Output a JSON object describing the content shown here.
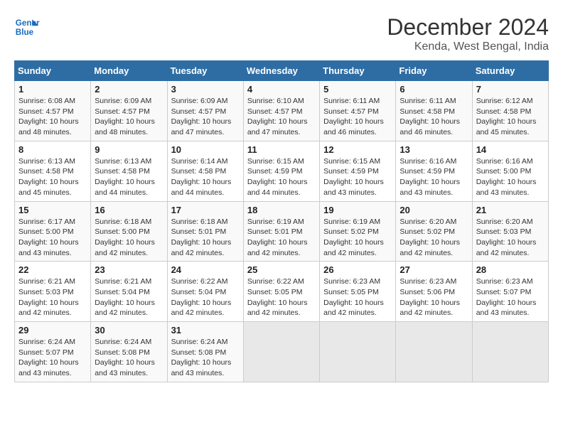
{
  "logo": {
    "line1": "General",
    "line2": "Blue"
  },
  "title": "December 2024",
  "subtitle": "Kenda, West Bengal, India",
  "weekdays": [
    "Sunday",
    "Monday",
    "Tuesday",
    "Wednesday",
    "Thursday",
    "Friday",
    "Saturday"
  ],
  "weeks": [
    [
      {
        "day": "1",
        "sunrise": "6:08 AM",
        "sunset": "4:57 PM",
        "daylight": "10 hours and 48 minutes."
      },
      {
        "day": "2",
        "sunrise": "6:09 AM",
        "sunset": "4:57 PM",
        "daylight": "10 hours and 48 minutes."
      },
      {
        "day": "3",
        "sunrise": "6:09 AM",
        "sunset": "4:57 PM",
        "daylight": "10 hours and 47 minutes."
      },
      {
        "day": "4",
        "sunrise": "6:10 AM",
        "sunset": "4:57 PM",
        "daylight": "10 hours and 47 minutes."
      },
      {
        "day": "5",
        "sunrise": "6:11 AM",
        "sunset": "4:57 PM",
        "daylight": "10 hours and 46 minutes."
      },
      {
        "day": "6",
        "sunrise": "6:11 AM",
        "sunset": "4:58 PM",
        "daylight": "10 hours and 46 minutes."
      },
      {
        "day": "7",
        "sunrise": "6:12 AM",
        "sunset": "4:58 PM",
        "daylight": "10 hours and 45 minutes."
      }
    ],
    [
      {
        "day": "8",
        "sunrise": "6:13 AM",
        "sunset": "4:58 PM",
        "daylight": "10 hours and 45 minutes."
      },
      {
        "day": "9",
        "sunrise": "6:13 AM",
        "sunset": "4:58 PM",
        "daylight": "10 hours and 44 minutes."
      },
      {
        "day": "10",
        "sunrise": "6:14 AM",
        "sunset": "4:58 PM",
        "daylight": "10 hours and 44 minutes."
      },
      {
        "day": "11",
        "sunrise": "6:15 AM",
        "sunset": "4:59 PM",
        "daylight": "10 hours and 44 minutes."
      },
      {
        "day": "12",
        "sunrise": "6:15 AM",
        "sunset": "4:59 PM",
        "daylight": "10 hours and 43 minutes."
      },
      {
        "day": "13",
        "sunrise": "6:16 AM",
        "sunset": "4:59 PM",
        "daylight": "10 hours and 43 minutes."
      },
      {
        "day": "14",
        "sunrise": "6:16 AM",
        "sunset": "5:00 PM",
        "daylight": "10 hours and 43 minutes."
      }
    ],
    [
      {
        "day": "15",
        "sunrise": "6:17 AM",
        "sunset": "5:00 PM",
        "daylight": "10 hours and 43 minutes."
      },
      {
        "day": "16",
        "sunrise": "6:18 AM",
        "sunset": "5:00 PM",
        "daylight": "10 hours and 42 minutes."
      },
      {
        "day": "17",
        "sunrise": "6:18 AM",
        "sunset": "5:01 PM",
        "daylight": "10 hours and 42 minutes."
      },
      {
        "day": "18",
        "sunrise": "6:19 AM",
        "sunset": "5:01 PM",
        "daylight": "10 hours and 42 minutes."
      },
      {
        "day": "19",
        "sunrise": "6:19 AM",
        "sunset": "5:02 PM",
        "daylight": "10 hours and 42 minutes."
      },
      {
        "day": "20",
        "sunrise": "6:20 AM",
        "sunset": "5:02 PM",
        "daylight": "10 hours and 42 minutes."
      },
      {
        "day": "21",
        "sunrise": "6:20 AM",
        "sunset": "5:03 PM",
        "daylight": "10 hours and 42 minutes."
      }
    ],
    [
      {
        "day": "22",
        "sunrise": "6:21 AM",
        "sunset": "5:03 PM",
        "daylight": "10 hours and 42 minutes."
      },
      {
        "day": "23",
        "sunrise": "6:21 AM",
        "sunset": "5:04 PM",
        "daylight": "10 hours and 42 minutes."
      },
      {
        "day": "24",
        "sunrise": "6:22 AM",
        "sunset": "5:04 PM",
        "daylight": "10 hours and 42 minutes."
      },
      {
        "day": "25",
        "sunrise": "6:22 AM",
        "sunset": "5:05 PM",
        "daylight": "10 hours and 42 minutes."
      },
      {
        "day": "26",
        "sunrise": "6:23 AM",
        "sunset": "5:05 PM",
        "daylight": "10 hours and 42 minutes."
      },
      {
        "day": "27",
        "sunrise": "6:23 AM",
        "sunset": "5:06 PM",
        "daylight": "10 hours and 42 minutes."
      },
      {
        "day": "28",
        "sunrise": "6:23 AM",
        "sunset": "5:07 PM",
        "daylight": "10 hours and 43 minutes."
      }
    ],
    [
      {
        "day": "29",
        "sunrise": "6:24 AM",
        "sunset": "5:07 PM",
        "daylight": "10 hours and 43 minutes."
      },
      {
        "day": "30",
        "sunrise": "6:24 AM",
        "sunset": "5:08 PM",
        "daylight": "10 hours and 43 minutes."
      },
      {
        "day": "31",
        "sunrise": "6:24 AM",
        "sunset": "5:08 PM",
        "daylight": "10 hours and 43 minutes."
      },
      null,
      null,
      null,
      null
    ]
  ]
}
